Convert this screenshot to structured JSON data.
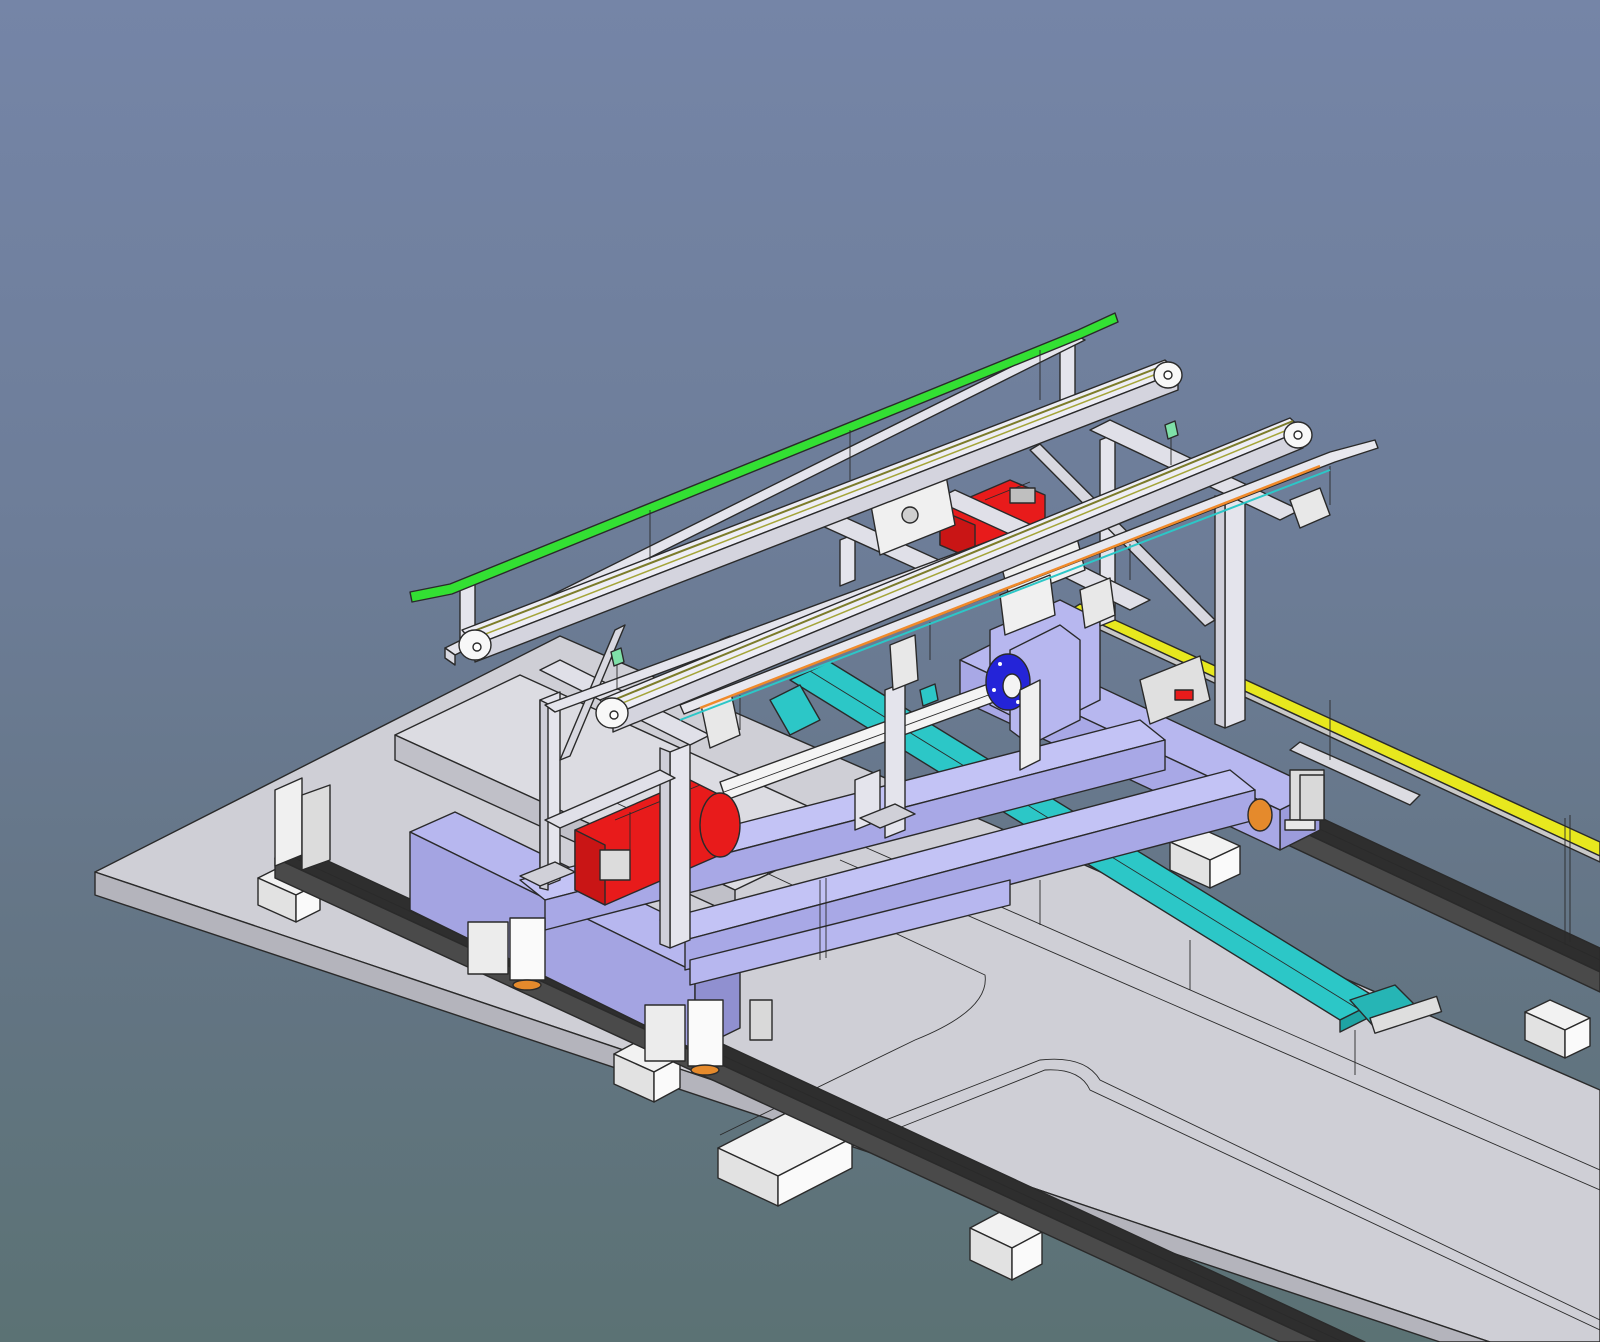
{
  "window": {
    "title": ""
  },
  "viewport": {
    "background_top": "#7585a7",
    "background_bottom": "#5b7274",
    "view": "isometric"
  },
  "model": {
    "parts": [
      {
        "name": "base-plate",
        "color": "#cfcfd6"
      },
      {
        "name": "floor-rail",
        "color": "#2e2e2e"
      },
      {
        "name": "rail-support-block",
        "color": "#f2f2f2"
      },
      {
        "name": "carriage-frame",
        "color": "#b7b7ef"
      },
      {
        "name": "aluminium-frame",
        "color": "#e4e4ec"
      },
      {
        "name": "conveyor-belt",
        "color": "#eeeef6"
      },
      {
        "name": "guide-rail-green",
        "color": "#33e033"
      },
      {
        "name": "guide-rail-yellow",
        "color": "#e8e81e"
      },
      {
        "name": "drive-motor",
        "color": "#e81b1b"
      },
      {
        "name": "cable-chain",
        "color": "#2cc7c7"
      },
      {
        "name": "drive-shaft",
        "color": "#f4f4f4"
      },
      {
        "name": "shaft-flange",
        "color": "#2424d8"
      },
      {
        "name": "sensor",
        "color": "#7fe0a8"
      }
    ]
  }
}
